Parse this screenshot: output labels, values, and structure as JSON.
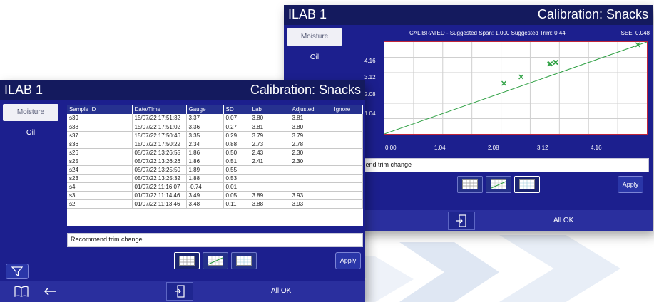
{
  "background_colors": {
    "screen": "#1c1f8e",
    "titlebar": "#141a5e",
    "plot_line": "#2ea043",
    "plot_border": "#c0263a"
  },
  "chart_screen": {
    "title_left": "ILAB 1",
    "title_right": "Calibration: Snacks",
    "side_tabs": [
      "Moisture"
    ],
    "side_items": [
      "Oil"
    ],
    "header_status": "CALIBRATED - Suggested Span: 1.000   Suggested Trim: 0.44",
    "header_see": "SEE: 0.048",
    "message": "mend trim change",
    "apply_label": "Apply",
    "status": "All OK",
    "icons": [
      "grid-view-icon",
      "chart-view-icon",
      "scatter-view-icon",
      "exit-door-icon"
    ]
  },
  "table_screen": {
    "title_left": "ILAB 1",
    "title_right": "Calibration: Snacks",
    "side_tabs": [
      "Moisture"
    ],
    "side_items": [
      "Oil"
    ],
    "columns": [
      "Sample ID",
      "Date/Time",
      "Gauge",
      "SD",
      "Lab",
      "Adjusted",
      "Ignore"
    ],
    "rows": [
      [
        "s39",
        "15/07/22 17:51:32",
        "3.37",
        "0.07",
        "3.80",
        "3.81",
        ""
      ],
      [
        "s38",
        "15/07/22 17:51:02",
        "3.36",
        "0.27",
        "3.81",
        "3.80",
        ""
      ],
      [
        "s37",
        "15/07/22 17:50:46",
        "3.35",
        "0.29",
        "3.79",
        "3.79",
        ""
      ],
      [
        "s36",
        "15/07/22 17:50:22",
        "2.34",
        "0.88",
        "2.73",
        "2.78",
        ""
      ],
      [
        "s26",
        "05/07/22 13:26:55",
        "1.86",
        "0.50",
        "2.43",
        "2.30",
        ""
      ],
      [
        "s25",
        "05/07/22 13:26:26",
        "1.86",
        "0.51",
        "2.41",
        "2.30",
        ""
      ],
      [
        "s24",
        "05/07/22 13:25:50",
        "1.89",
        "0.55",
        "",
        "",
        ""
      ],
      [
        "s23",
        "05/07/22 13:25:32",
        "1.88",
        "0.53",
        "",
        "",
        ""
      ],
      [
        "s4",
        "01/07/22 11:16:07",
        "-0.74",
        "0.01",
        "",
        "",
        ""
      ],
      [
        "s3",
        "01/07/22 11:14:46",
        "3.49",
        "0.05",
        "3.89",
        "3.93",
        ""
      ],
      [
        "s2",
        "01/07/22 11:13:46",
        "3.48",
        "0.11",
        "3.88",
        "3.93",
        ""
      ]
    ],
    "message": "Recommend trim change",
    "apply_label": "Apply",
    "status": "All OK",
    "icons": [
      "filter-icon",
      "book-icon",
      "back-arrow-icon",
      "exit-door-icon"
    ]
  },
  "chart_data": {
    "type": "scatter",
    "title": "",
    "xlabel": "",
    "ylabel": "",
    "x_ticks": [
      "0.00",
      "1.04",
      "2.08",
      "3.12",
      "4.16"
    ],
    "y_ticks": [
      "4.16",
      "3.12",
      "2.08",
      "1.04"
    ],
    "xlim": [
      -0.3,
      5.5
    ],
    "ylim": [
      -0.05,
      5.0
    ],
    "grid": true,
    "series": [
      {
        "points": [
          [
            2.34,
            2.73
          ],
          [
            2.72,
            3.08
          ],
          [
            3.35,
            3.79
          ],
          [
            3.37,
            3.8
          ],
          [
            3.49,
            3.89
          ],
          [
            3.48,
            3.88
          ],
          [
            5.3,
            4.85
          ]
        ]
      }
    ],
    "fit_line": [
      [
        -0.3,
        -0.05
      ],
      [
        5.5,
        5.0
      ]
    ]
  }
}
